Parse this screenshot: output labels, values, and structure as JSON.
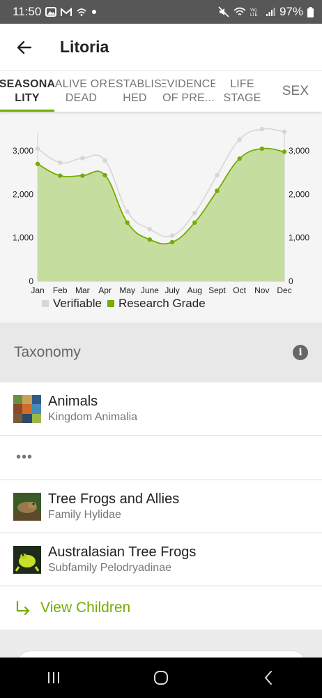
{
  "status_bar": {
    "time": "11:50",
    "battery": "97%"
  },
  "app_bar": {
    "title": "Litoria"
  },
  "tabs": [
    {
      "label": "SEASONA\nLITY",
      "active": true
    },
    {
      "label": "ALIVE OR\nDEAD",
      "active": false
    },
    {
      "label": "ESTABLIS\nHED",
      "active": false
    },
    {
      "label": "EVIDENCE\nOF PRE...",
      "active": false
    },
    {
      "label": "LIFE\nSTAGE",
      "active": false
    },
    {
      "label": "SEX",
      "active": false
    }
  ],
  "chart_data": {
    "type": "area",
    "categories": [
      "Jan",
      "Feb",
      "Mar",
      "Apr",
      "May",
      "June",
      "July",
      "Aug",
      "Sept",
      "Oct",
      "Nov",
      "Dec"
    ],
    "series": [
      {
        "name": "Verifiable",
        "color": "#d6d6d6",
        "values": [
          3050,
          2730,
          2830,
          2780,
          1600,
          1200,
          1050,
          1570,
          2440,
          3260,
          3500,
          3440
        ]
      },
      {
        "name": "Research Grade",
        "color": "#74ac00",
        "values": [
          2700,
          2430,
          2430,
          2440,
          1350,
          960,
          900,
          1350,
          2080,
          2820,
          3050,
          2980
        ]
      }
    ],
    "ylim": [
      0,
      3500
    ],
    "yticks": [
      0,
      1000,
      2000,
      3000
    ],
    "ytick_labels": [
      "0",
      "1,000",
      "2,000",
      "3,000"
    ],
    "fill_color": "#c5dea0",
    "legend": "bottom-left",
    "grid": false
  },
  "taxonomy": {
    "title": "Taxonomy",
    "items": [
      {
        "name": "Animals",
        "rank": "Kingdom Animalia",
        "thumb": "animals-photo"
      },
      {
        "name": "Tree Frogs and Allies",
        "rank": "Family Hylidae",
        "thumb": "brown-frog-photo"
      },
      {
        "name": "Australasian Tree Frogs",
        "rank": "Subfamily Pelodryadinae",
        "thumb": "green-frog-photo"
      }
    ],
    "ellipsis": "•••",
    "view_children": "View Children"
  },
  "colors": {
    "accent": "#74ac00",
    "status_bar": "#575757"
  }
}
